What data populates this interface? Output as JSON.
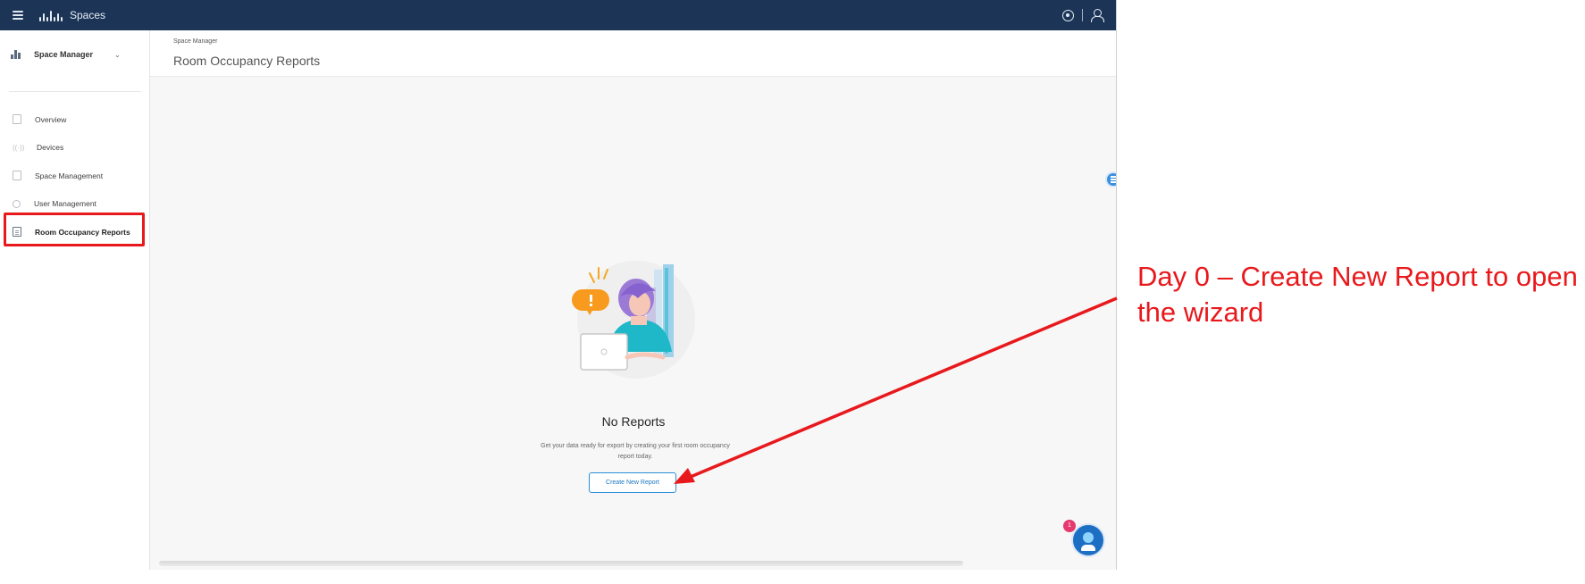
{
  "topbar": {
    "brand_name": "Spaces",
    "icons": [
      "hamburger-menu-icon",
      "cisco-logo-icon",
      "help-icon",
      "user-icon"
    ]
  },
  "sidebar": {
    "switcher_label": "Space Manager",
    "items": [
      {
        "label": "Overview",
        "icon": "overview-icon",
        "active": false
      },
      {
        "label": "Devices",
        "icon": "devices-icon",
        "active": false
      },
      {
        "label": "Space Management",
        "icon": "space-management-icon",
        "active": false
      },
      {
        "label": "User Management",
        "icon": "user-management-icon",
        "active": false
      },
      {
        "label": "Room Occupancy Reports",
        "icon": "reports-icon",
        "active": true
      }
    ]
  },
  "header": {
    "breadcrumb": "Space Manager",
    "title": "Room Occupancy Reports"
  },
  "empty_state": {
    "title": "No Reports",
    "description": "Get your data ready for export by creating your first room occupancy report today.",
    "button_label": "Create New Report"
  },
  "assistant": {
    "badge_count": "1"
  },
  "annotation": {
    "text": "Day 0 – Create New Report to open the wizard",
    "color": "#e8191c"
  },
  "colors": {
    "topbar": "#1c3557",
    "accent": "#2b8fd6",
    "highlight": "#e8191c"
  }
}
